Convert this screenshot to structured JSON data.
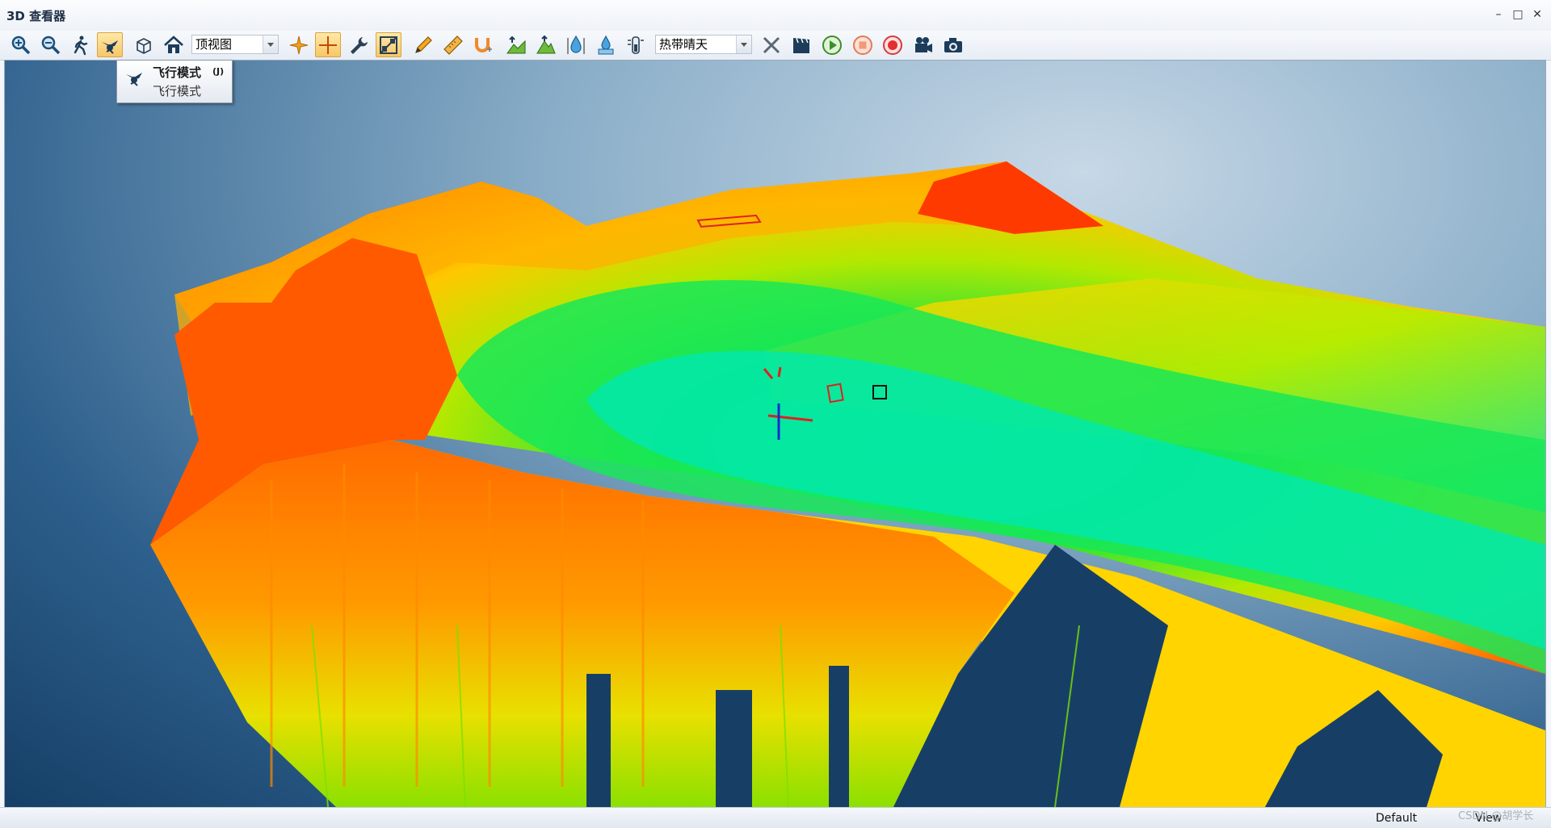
{
  "window": {
    "title": "3D 查看器"
  },
  "toolbar": {
    "view_select": {
      "value": "顶视图"
    },
    "weather_select": {
      "value": "热带晴天"
    },
    "icons": [
      "zoom-in-icon",
      "zoom-out-icon",
      "walk-icon",
      "fly-icon",
      "box-icon",
      "home-icon",
      "crosshair-icon",
      "axis-cross-icon",
      "wrench-icon",
      "slope-icon",
      "pencil-icon",
      "ruler-icon",
      "magnet-icon",
      "terrain-raise-icon",
      "terrain-peak-icon",
      "water-drop-icon",
      "water-level-icon",
      "gauge-icon",
      "tools-cross-icon",
      "clapper-icon",
      "play-icon",
      "stop-icon",
      "record-icon",
      "video-camera-icon",
      "camera-icon"
    ]
  },
  "tooltip": {
    "title": "飞行模式",
    "shortcut": "(J)",
    "description": "飞行模式"
  },
  "status": {
    "left": "Default",
    "right": "View"
  },
  "watermark": "CSDN @胡学长",
  "colors": {
    "accent_active": "#f7c767",
    "terrain_high": "#ff2a00",
    "terrain_low": "#00e5c0",
    "background": "#153f66"
  }
}
